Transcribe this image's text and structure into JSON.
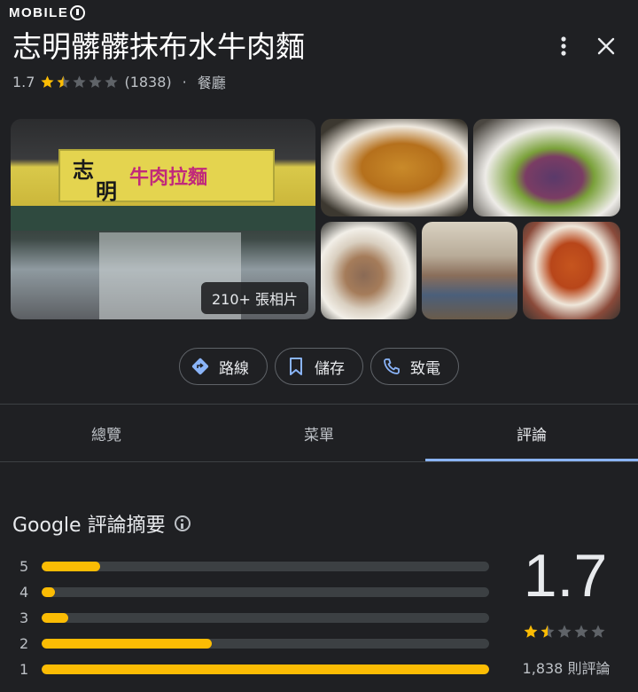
{
  "watermark": "MOBILE01",
  "place": {
    "name": "志明髒髒抹布水牛肉麵",
    "rating": "1.7",
    "stars": [
      1,
      0.5,
      0,
      0,
      0
    ],
    "review_count_paren": "(1838)",
    "separator": "·",
    "category": "餐廳"
  },
  "photos": {
    "count_badge": "210+ 張相片",
    "sign_chars": [
      "志",
      "明",
      "牛肉拉麵"
    ]
  },
  "actions": [
    {
      "label": "路線",
      "icon": "directions-icon"
    },
    {
      "label": "儲存",
      "icon": "bookmark-icon"
    },
    {
      "label": "致電",
      "icon": "phone-icon"
    }
  ],
  "tabs": [
    {
      "label": "總覽",
      "active": false
    },
    {
      "label": "菜單",
      "active": false
    },
    {
      "label": "評論",
      "active": true
    }
  ],
  "summary": {
    "title": "Google 評論摘要",
    "distribution": [
      {
        "star": "5",
        "fraction": 0.13
      },
      {
        "star": "4",
        "fraction": 0.03
      },
      {
        "star": "3",
        "fraction": 0.06
      },
      {
        "star": "2",
        "fraction": 0.38
      },
      {
        "star": "1",
        "fraction": 1.0
      }
    ],
    "score": "1.7",
    "review_count": "1,838 則評論"
  },
  "colors": {
    "accent": "#8ab4f8",
    "star": "#fbbc04",
    "star_empty": "#5f6368",
    "background": "#1f2023"
  }
}
